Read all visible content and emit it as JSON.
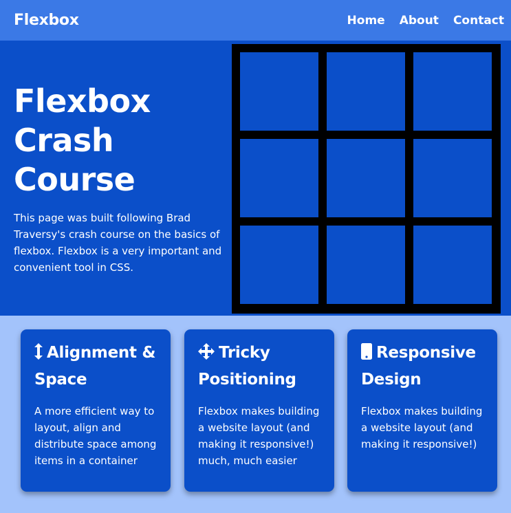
{
  "navbar": {
    "brand": "Flexbox",
    "links": [
      {
        "label": "Home"
      },
      {
        "label": "About"
      },
      {
        "label": "Contact"
      }
    ]
  },
  "hero": {
    "title": "Flexbox Crash Course",
    "text": "This page was built following Brad Traversy's crash course on the basics of flexbox. Flexbox is a very important and convenient tool in CSS.",
    "grid_cells": 9
  },
  "cards": [
    {
      "icon": "vertical-arrows-icon",
      "title": "Alignment & Space",
      "text": "A more efficient way to layout, align and distribute space among items in a container"
    },
    {
      "icon": "move-arrows-icon",
      "title": "Tricky Positioning",
      "text": "Flexbox makes building a website layout (and making it responsive!) much, much easier"
    },
    {
      "icon": "mobile-phone-icon",
      "title": "Responsive Design",
      "text": "Flexbox makes building a website layout (and making it responsive!)"
    }
  ],
  "colors": {
    "nav_bg": "#3b79e6",
    "hero_bg": "#0b4fc9",
    "page_bg": "#a3c3fb",
    "grid_border": "#000000"
  }
}
